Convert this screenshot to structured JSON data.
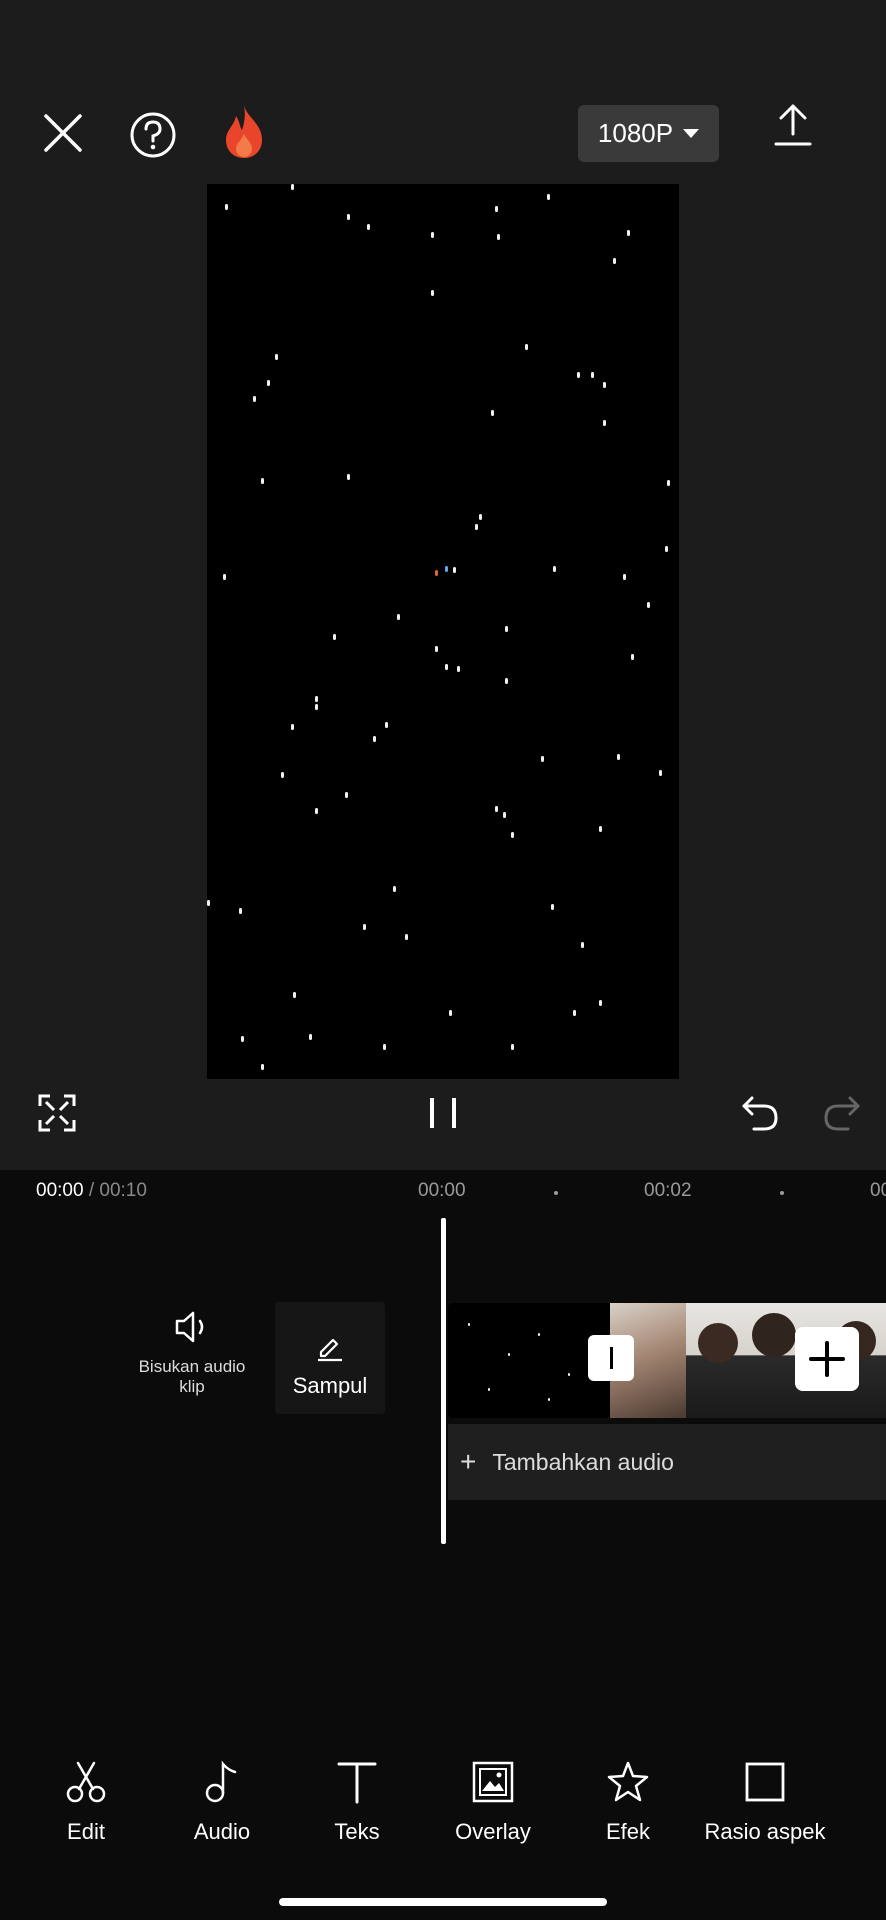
{
  "header": {
    "resolution_label": "1080P"
  },
  "playback": {
    "current_time": "00:00",
    "separator": " / ",
    "total_time": "00:10"
  },
  "ruler": {
    "ticks": [
      "00:00",
      "00:02",
      "00"
    ]
  },
  "clip_actions": {
    "mute_label": "Bisukan audio\nklip",
    "cover_label": "Sampul"
  },
  "timeline": {
    "add_audio_label": "Tambahkan audio"
  },
  "toolbar": {
    "items": [
      {
        "label": "Edit",
        "icon": "scissors-icon"
      },
      {
        "label": "Audio",
        "icon": "music-note-icon"
      },
      {
        "label": "Teks",
        "icon": "text-icon"
      },
      {
        "label": "Overlay",
        "icon": "overlay-icon"
      },
      {
        "label": "Efek",
        "icon": "sparkle-star-icon"
      },
      {
        "label": "Rasio aspek",
        "icon": "aspect-ratio-icon"
      }
    ]
  },
  "colors": {
    "top_background": "#1c1c1c",
    "timeline_background": "#0b0b0b",
    "flame": "#e8452b"
  }
}
